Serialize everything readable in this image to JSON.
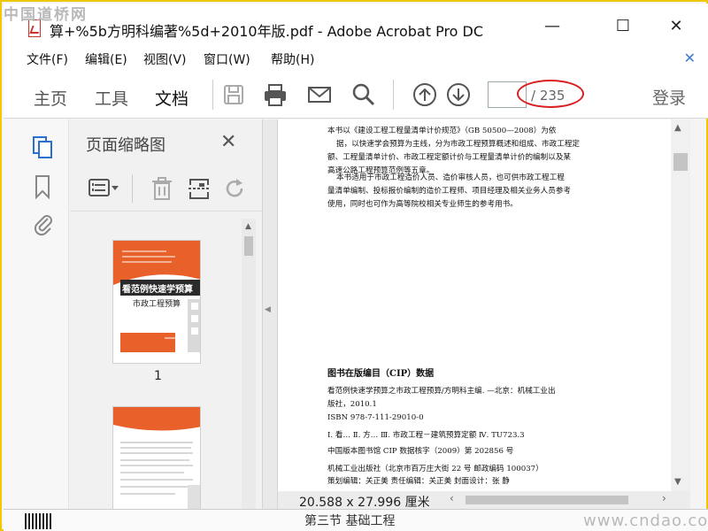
{
  "watermark": {
    "top": "中国道桥网",
    "bottom": "www.cndao.com"
  },
  "window": {
    "title": "算+%5b方明科编著%5d+2010年版.pdf - Adobe Acrobat Pro DC",
    "minimize": "—",
    "maximize": "☐",
    "close": "✕"
  },
  "menu": {
    "items": [
      "文件(F)",
      "编辑(E)",
      "视图(V)",
      "窗口(W)",
      "帮助(H)"
    ],
    "close": "✕"
  },
  "toolbar": {
    "tabs": [
      "主页",
      "工具",
      "文档"
    ],
    "active_tab": "文档",
    "page_current": "",
    "page_total": "/ 235",
    "login": "登录"
  },
  "sidebar": {
    "title": "页面缩略图",
    "close": "✕",
    "thumb1_label": "1",
    "cover_title": "看范例快速学预算",
    "cover_subtitle": "市政工程预算"
  },
  "document": {
    "lines": [
      "本书以《建设工程工程量清单计价规范》（GB 50500—2008）为依",
      "据，以快速学会预算为主线，分为市政工程预算概述和组成、市政工程定",
      "额、工程量清单计价、市政工程定额计价与工程量清单计价的编制以及某",
      "高速公路工程预算范例等五章。",
      "本书适用于市政工程造价人员、造价审核人员，也可供市政工程工程",
      "量清单编制、投标报价编制的造价工程师、项目经理及相关业务人员参考",
      "使用，同时也可作为高等院校相关专业师生的参考用书。"
    ],
    "cip_heading": "图书在版编目（CIP）数据",
    "cip_lines": [
      "看范例快速学预算之市政工程预算/方明科主编. —北京：机械工业出",
      "版社，2010.1",
      "ISBN 978-7-111-29010-0",
      "Ⅰ. 看…  Ⅱ. 方…  Ⅲ. 市政工程－建筑预算定额  Ⅳ. TU723.3",
      "中国版本图书馆 CIP 数据核字（2009）第 202856 号",
      "机械工业出版社（北京市百万庄大街 22 号   邮政编码 100037）",
      "策划编辑：关正美   责任编辑：关正美   封面设计：张   静"
    ]
  },
  "status": {
    "dimension": "20.588 x 27.996 厘米",
    "bottom_fragment": "第三节  基础工程"
  },
  "colors": {
    "cover_orange": "#e8602a",
    "highlight": "#d82020",
    "icon_blue": "#2a6fd0",
    "frame": "#f0c800"
  }
}
